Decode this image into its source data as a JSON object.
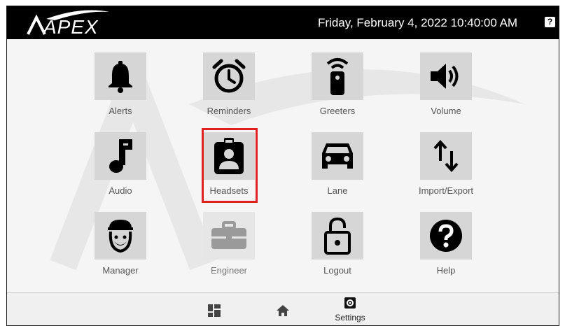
{
  "header": {
    "logo_text": "APEX",
    "datetime": "Friday, February 4, 2022 10:40:00 AM",
    "help_glyph": "?"
  },
  "tiles": [
    {
      "label": "Alerts",
      "icon": "bell-icon"
    },
    {
      "label": "Reminders",
      "icon": "alarm-clock-icon"
    },
    {
      "label": "Greeters",
      "icon": "remote-signal-icon"
    },
    {
      "label": "Volume",
      "icon": "speaker-icon"
    },
    {
      "label": "Audio",
      "icon": "music-note-icon"
    },
    {
      "label": "Headsets",
      "icon": "id-badge-icon",
      "selected": true
    },
    {
      "label": "Lane",
      "icon": "car-icon"
    },
    {
      "label": "Import/Export",
      "icon": "up-down-arrows-icon"
    },
    {
      "label": "Manager",
      "icon": "manager-avatar-icon"
    },
    {
      "label": "Engineer",
      "icon": "toolbox-icon",
      "disabled": true
    },
    {
      "label": "Logout",
      "icon": "padlock-open-icon"
    },
    {
      "label": "Help",
      "icon": "question-circle-icon"
    }
  ],
  "nav": {
    "dashboard_icon": "dashboard-grid-icon",
    "home_icon": "home-icon",
    "settings_label": "Settings",
    "settings_icon": "settings-gear-icon"
  },
  "colors": {
    "header_bg": "#000000",
    "tile_bg": "#d6d6d6",
    "highlight": "#e02020"
  }
}
